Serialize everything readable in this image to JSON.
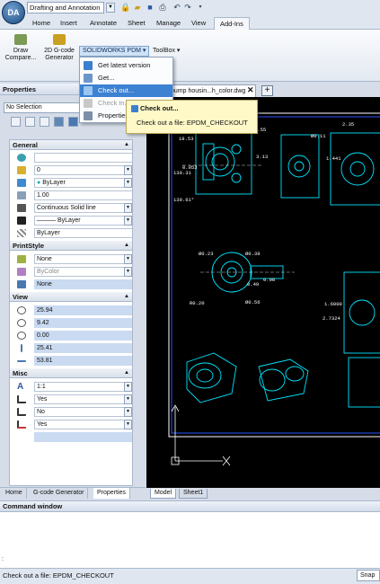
{
  "quick_access": {
    "workspace": "Drafting and Annotation",
    "icons": [
      "lock-icon",
      "open-folder-icon",
      "save-icon",
      "print-icon",
      "undo-icon",
      "redo-icon",
      "customize-arrow-icon"
    ]
  },
  "ribbon_tabs": [
    "Home",
    "Insert",
    "Annotate",
    "Sheet",
    "Manage",
    "View",
    "Add-Ins"
  ],
  "active_tab": "Add-Ins",
  "ribbon": {
    "draw_compare": [
      "Draw",
      "Compare..."
    ],
    "gcode": [
      "2D G-code",
      "Generator"
    ],
    "pdm": "SOLIDWORKS PDM",
    "toolbox": "ToolBox"
  },
  "pdm_menu": {
    "items": [
      {
        "label": "Get latest version",
        "state": "normal"
      },
      {
        "label": "Get...",
        "state": "normal"
      },
      {
        "label": "Check out...",
        "state": "selected"
      },
      {
        "label": "Check In...",
        "state": "disabled"
      },
      {
        "label": "Properties",
        "state": "normal"
      }
    ]
  },
  "tooltip": {
    "title": "Check out...",
    "text": "Check out a file: EPDM_CHECKOUT"
  },
  "properties": {
    "title": "Properties",
    "selection": "No Selection",
    "general": {
      "title": "General",
      "rows": [
        "",
        "0",
        "ByLayer",
        "1.00",
        "Continuous    Solid line",
        "ByLayer",
        "ByLayer"
      ]
    },
    "printstyle": {
      "title": "PrintStyle",
      "rows": [
        "None",
        "ByColor",
        "None"
      ]
    },
    "view": {
      "title": "View",
      "rows": [
        "25.94",
        "9.42",
        "0.00",
        "25.41",
        "53.81"
      ]
    },
    "misc": {
      "title": "Misc",
      "rows": [
        "1:1",
        "Yes",
        "No",
        "Yes",
        ""
      ]
    }
  },
  "left_tabs": [
    "Home",
    "G-code Generator",
    "Properties"
  ],
  "active_left_tab": "Properties",
  "document_tab": "pump housin...h_color.dwg",
  "model_tabs": [
    "Model",
    "Sheet1"
  ],
  "drawing_labels": [
    "18.53",
    "1.55",
    "3.13",
    "0.053",
    "130.31",
    "139.61°",
    "Ø0.23",
    "Ø0.39",
    "0.98",
    "0.49",
    "R0.20",
    "Ø0.56",
    "2.35",
    "Ø0.11",
    "1.441",
    "2.7324",
    "1.6000"
  ],
  "command_window": {
    "title": "Command window",
    "prompt": ":"
  },
  "status": {
    "text": "Check out a file: EPDM_CHECKOUT",
    "snap": "Snap"
  }
}
